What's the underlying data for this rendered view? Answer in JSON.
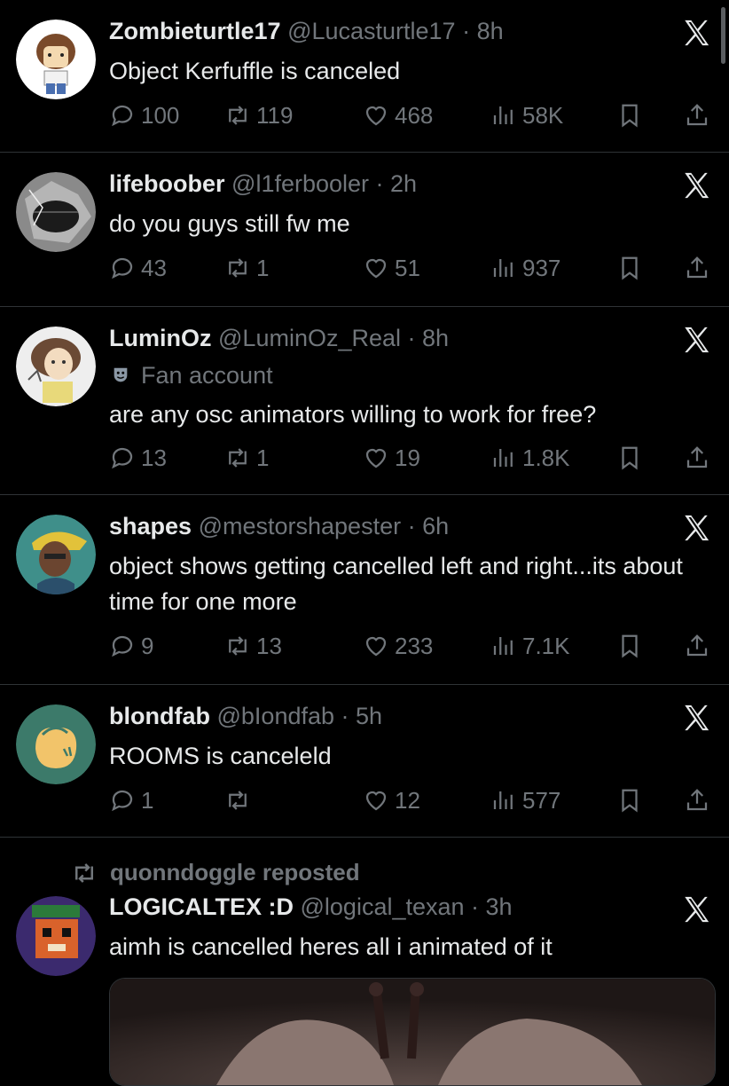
{
  "tweets": [
    {
      "display_name": "Zombieturtle17",
      "handle": "@Lucasturtle17",
      "time": "· 8h",
      "badge": "",
      "text": "Object Kerfuffle is canceled",
      "replies": "100",
      "reposts": "119",
      "likes": "468",
      "views": "58K"
    },
    {
      "display_name": "lifeboober",
      "handle": "@l1ferbooler",
      "time": "· 2h",
      "badge": "",
      "text": "do you guys still fw me",
      "replies": "43",
      "reposts": "1",
      "likes": "51",
      "views": "937"
    },
    {
      "display_name": "LuminOz",
      "handle": "@LuminOz_Real",
      "time": "· 8h",
      "badge": "Fan account",
      "text": "are any osc animators willing to work for free?",
      "replies": "13",
      "reposts": "1",
      "likes": "19",
      "views": "1.8K"
    },
    {
      "display_name": "shapes",
      "handle": "@mestorshapester",
      "time": "· 6h",
      "badge": "",
      "text": "object shows getting cancelled left and right...its about time for one more",
      "replies": "9",
      "reposts": "13",
      "likes": "233",
      "views": "7.1K"
    },
    {
      "display_name": "blondfab",
      "handle": "@bIondfab",
      "time": "· 5h",
      "badge": "",
      "text": "ROOMS is canceleld",
      "replies": "1",
      "reposts": "",
      "likes": "12",
      "views": "577"
    },
    {
      "reposted_by": "quonndoggle reposted",
      "display_name": "LOGICALTEX :D",
      "handle": "@logical_texan",
      "time": "· 3h",
      "badge": "",
      "text": "aimh is cancelled heres all i animated of it"
    }
  ],
  "icons": {
    "reply": "speech-bubble-icon",
    "repost": "repost-arrows-icon",
    "like": "heart-icon",
    "views": "bar-chart-icon",
    "bookmark": "bookmark-icon",
    "share": "share-icon",
    "grok": "x-logo-icon",
    "fan": "theater-mask-icon"
  },
  "colors": {
    "background": "#000000",
    "text": "#e7e9ea",
    "secondary": "#71767b",
    "divider": "#2f3336"
  }
}
